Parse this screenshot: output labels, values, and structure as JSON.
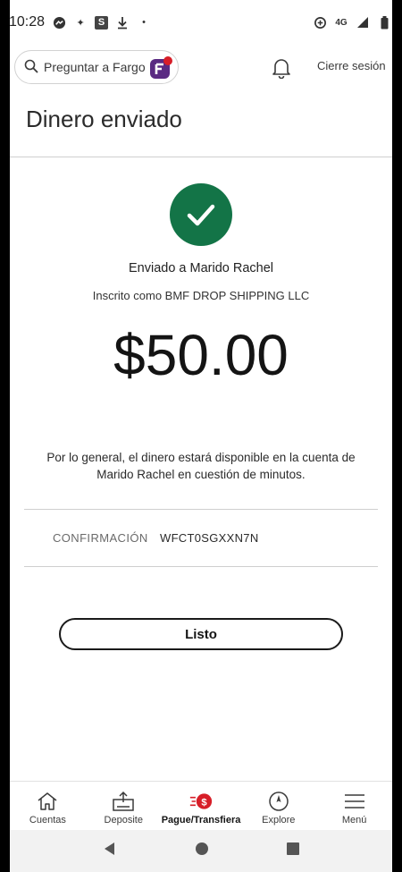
{
  "status_bar": {
    "time": "10:28",
    "network": "4G"
  },
  "header": {
    "search_placeholder": "Preguntar a Fargo",
    "logout_label": "Cierre sesión"
  },
  "page": {
    "title": "Dinero enviado"
  },
  "confirmation": {
    "sent_to": "Enviado a Marido Rachel",
    "registered_as": "Inscrito como BMF DROP SHIPPING LLC",
    "amount": "$50.00",
    "note": "Por lo general, el dinero estará disponible en la cuenta de Marido Rachel en cuestión de minutos.",
    "code_label": "CONFIRMACIÓN",
    "code_value": "WFCT0SGXXN7N",
    "done_label": "Listo"
  },
  "tabs": [
    {
      "label": "Cuentas",
      "icon": "home-icon"
    },
    {
      "label": "Deposite",
      "icon": "deposit-icon"
    },
    {
      "label": "Pague/Transfiera",
      "icon": "pay-transfer-icon",
      "active": true
    },
    {
      "label": "Explore",
      "icon": "compass-icon"
    },
    {
      "label": "Menú",
      "icon": "hamburger-menu-icon"
    }
  ],
  "colors": {
    "success_green": "#137447",
    "brand_red": "#d71e28",
    "fargo_purple": "#5a2a82"
  }
}
